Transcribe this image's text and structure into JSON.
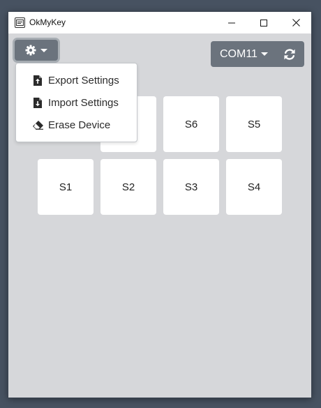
{
  "window": {
    "title": "OkMyKey"
  },
  "toolbar": {
    "settings_icon": "gear-icon",
    "port": {
      "selected": "COM11"
    },
    "refresh_icon": "refresh-icon"
  },
  "settings_menu": {
    "items": [
      {
        "label": "Export Settings",
        "icon": "file-export-icon"
      },
      {
        "label": "Import Settings",
        "icon": "file-import-icon"
      },
      {
        "label": "Erase Device",
        "icon": "eraser-icon"
      }
    ]
  },
  "slots": {
    "row1": [
      "S6",
      "S5"
    ],
    "row2": [
      "S1",
      "S2",
      "S3",
      "S4"
    ]
  },
  "colors": {
    "desktop": "#475261",
    "window_bg": "#d6d7da",
    "button": "#6b737d",
    "slot": "#ffffff"
  }
}
